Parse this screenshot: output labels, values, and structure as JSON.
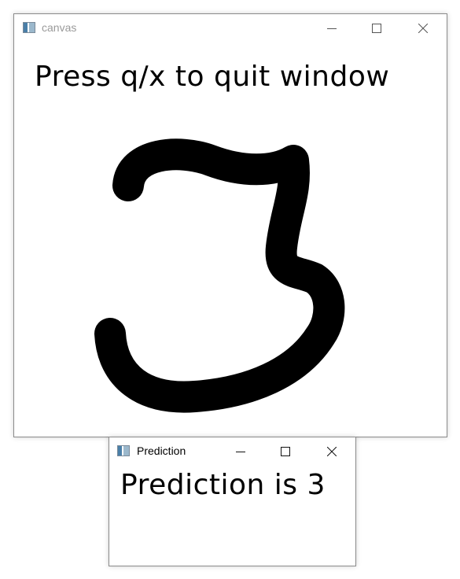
{
  "canvas_window": {
    "title": "canvas",
    "instruction": "Press q/x to quit window",
    "drawn_digit_icon": "handwritten-digit-3",
    "stroke_color": "#000000",
    "background_color": "#ffffff"
  },
  "prediction_window": {
    "title": "Prediction",
    "result_text": "Prediction is 3"
  },
  "window_controls": {
    "minimize_icon": "minimize-icon",
    "maximize_icon": "maximize-icon",
    "close_icon": "close-icon"
  },
  "colors": {
    "title_text_canvas": "#9a9a9a",
    "title_text_prediction": "#000000",
    "control_glyph": "#555555"
  }
}
